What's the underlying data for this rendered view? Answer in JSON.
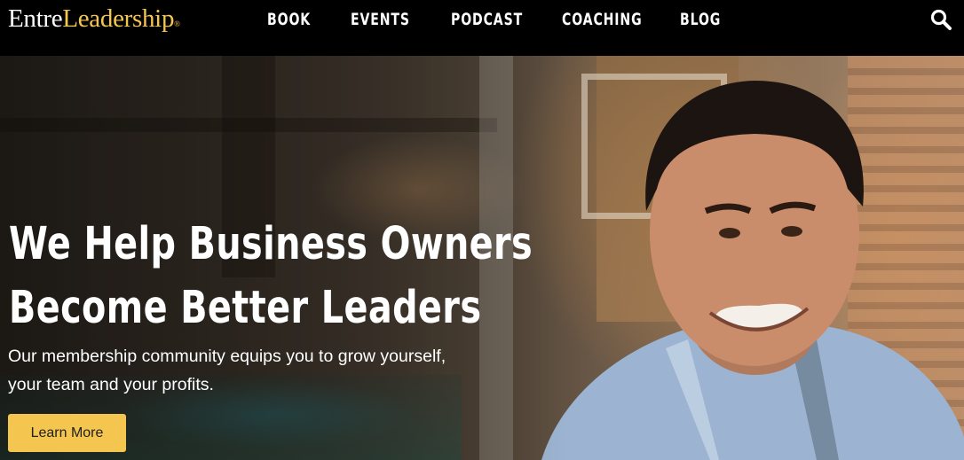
{
  "brand": {
    "logo_part1": "Entre",
    "logo_part2": "Leadership",
    "logo_mark": "®",
    "accent_color": "#f5c64f"
  },
  "nav": {
    "items": [
      "BOOK",
      "EVENTS",
      "PODCAST",
      "COACHING",
      "BLOG"
    ],
    "search_icon": "search-icon"
  },
  "hero": {
    "headline_line1": "We Help Business Owners",
    "headline_line2": "Become Better Leaders",
    "subtitle_line1": "Our membership community equips you to grow yourself,",
    "subtitle_line2": "your team and your profits.",
    "cta_label": "Learn More"
  }
}
